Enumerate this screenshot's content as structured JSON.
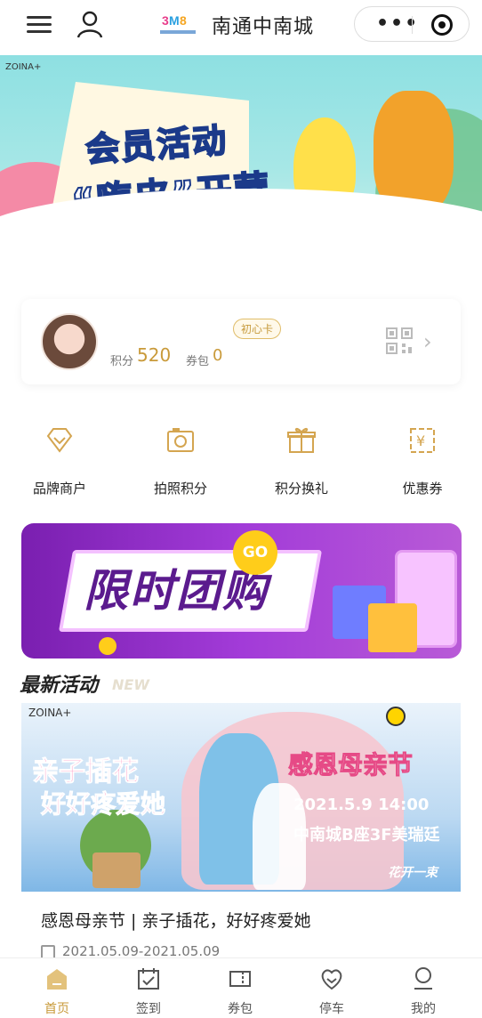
{
  "header": {
    "title": "南通中南城"
  },
  "banner": {
    "line1": "会员活动",
    "line2": "“嗨皮”开营",
    "brand": "ZOINA+"
  },
  "member": {
    "card_level": "初心卡",
    "points_label": "积分",
    "points_value": "520",
    "coupons_label": "券包",
    "coupons_value": "0"
  },
  "quick_menu": [
    {
      "label": "品牌商户",
      "icon": "diamond-icon"
    },
    {
      "label": "拍照积分",
      "icon": "camera-icon"
    },
    {
      "label": "积分换礼",
      "icon": "gift-icon"
    },
    {
      "label": "优惠券",
      "icon": "coupon-icon"
    }
  ],
  "promo": {
    "title": "限时团购",
    "go": "GO"
  },
  "section": {
    "title": "最新活动",
    "tag": "NEW"
  },
  "activity": {
    "image_left_1": "亲子插花",
    "image_left_2": "好好疼爱她",
    "image_right_title": "感恩母亲节",
    "image_time": "2021.5.9 14:00",
    "image_place": "中南城B座3F美瑞廷",
    "image_footer": "花开一束",
    "title": "感恩母亲节 | 亲子插花，好好疼爱她",
    "date": "2021.05.09-2021.05.09"
  },
  "tabs": [
    {
      "label": "首页",
      "icon": "home-icon",
      "active": true
    },
    {
      "label": "签到",
      "icon": "calendar-check-icon",
      "active": false
    },
    {
      "label": "券包",
      "icon": "ticket-icon",
      "active": false
    },
    {
      "label": "停车",
      "icon": "heart-car-icon",
      "active": false
    },
    {
      "label": "我的",
      "icon": "user-icon",
      "active": false
    }
  ],
  "colors": {
    "accent": "#c89a3a",
    "promo_purple": "#7a1fb0"
  }
}
